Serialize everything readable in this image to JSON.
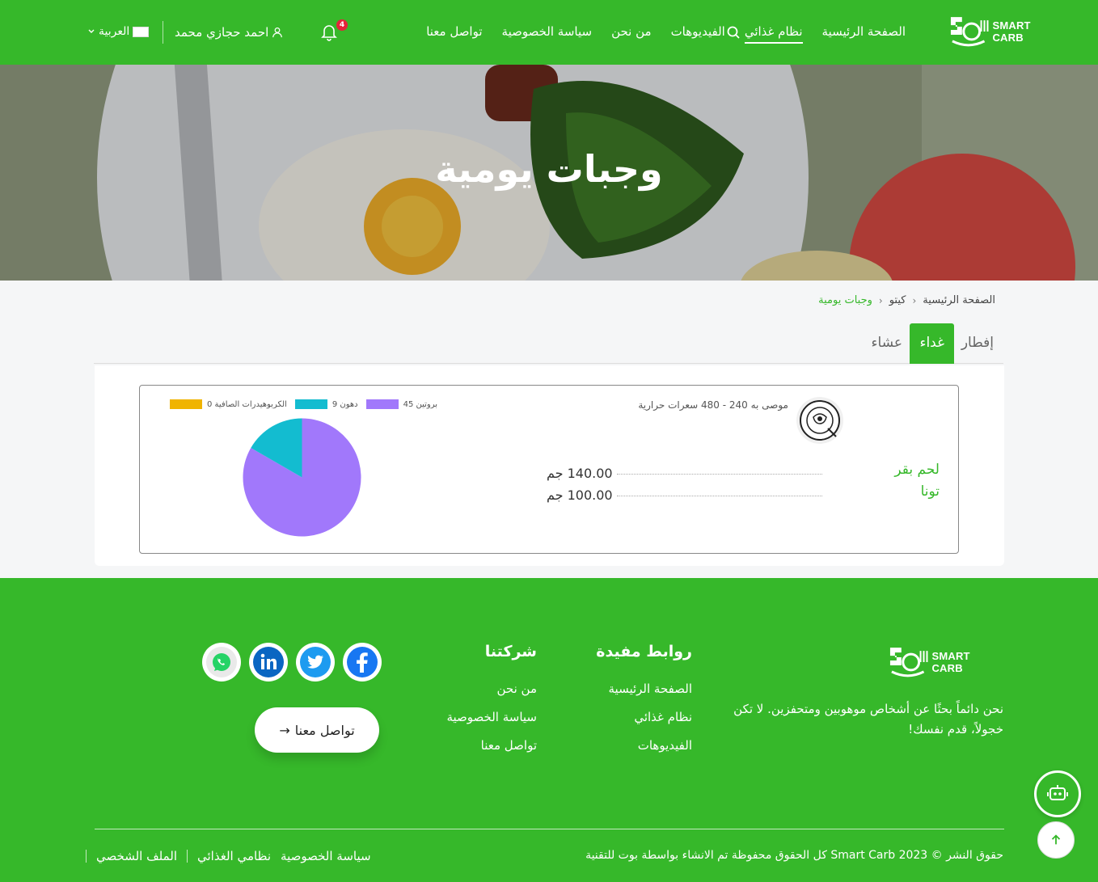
{
  "header": {
    "logo_text": "SMART CARB",
    "nav": [
      "الصفحة الرئيسية",
      "نظام غذائي",
      "الفيديوهات",
      "من نحن",
      "سياسة الخصوصية",
      "تواصل معنا"
    ],
    "active_nav_index": 1,
    "notification_count": "4",
    "user_name": "احمد حجازي محمد",
    "language": "العربية"
  },
  "hero": {
    "title": "وجبات يومية"
  },
  "breadcrumb": [
    "الصفحة الرئيسية",
    "كيتو",
    "وجبات يومية"
  ],
  "tabs": [
    "إفطار",
    "غداء",
    "عشاء"
  ],
  "active_tab_index": 1,
  "meal": {
    "recommendation": "موصى به 240 - 480 سعرات حرارية",
    "foods": [
      {
        "name": "لحم بقر",
        "qty": "140.00 جم"
      },
      {
        "name": "تونا",
        "qty": "100.00 جم"
      }
    ]
  },
  "chart_data": {
    "type": "pie",
    "series": [
      {
        "name": "بروتين",
        "value": 45,
        "color": "#a178fb",
        "legend": "بروتين 45"
      },
      {
        "name": "دهون",
        "value": 9,
        "color": "#13bcd0",
        "legend": "دهون 9"
      },
      {
        "name": "الكربوهيدرات الصافية",
        "value": 0,
        "color": "#f0b400",
        "legend": "الكربوهيدرات الصافية 0"
      }
    ]
  },
  "footer": {
    "logo_text": "SMART CARB",
    "about": "نحن دائماً بحثًا عن أشخاص موهوبين ومتحفزين. لا تكن خجولاً، قدم نفسك!",
    "useful_links_title": "روابط مفيدة",
    "useful_links": [
      "الصفحة الرئيسية",
      "نظام غذائي",
      "الفيديوهات"
    ],
    "company_title": "شركتنا",
    "company_links": [
      "من نحن",
      "سياسة الخصوصية",
      "تواصل معنا"
    ],
    "contact_button": "تواصل معنا",
    "copyright": "حقوق النشر © Smart Carb 2023 كل الحقوق محفوظة تم الانشاء بواسطة بوت للتقنية",
    "bottom_links": [
      "سياسة الخصوصية",
      "نظامي الغذائي",
      "الملف الشخصي"
    ]
  },
  "colors": {
    "brand_green": "#36b82a",
    "badge_red": "#e5243b"
  }
}
